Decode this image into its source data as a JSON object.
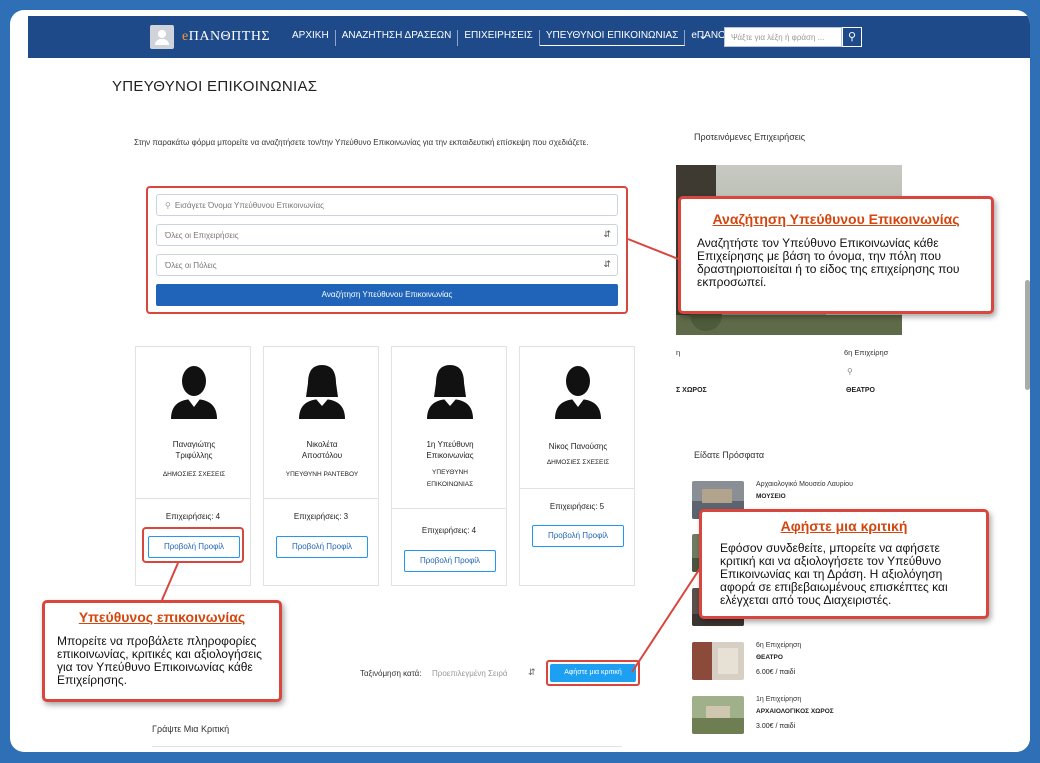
{
  "nav": {
    "logo_e": "e",
    "logo_rest": "ΠΑΝΘΠΤΗΣ",
    "links": [
      "ΑΡΧΙΚΗ",
      "ΑΝΑΖΗΤΗΣΗ ΔΡΑΣΕΩΝ",
      "ΕΠΙΧΕΙΡΗΣΕΙΣ",
      "ΥΠΕΥΘΥΝΟΙ ΕΠΙΚΟΙΝΩΝΙΑΣ",
      "eΠΑΝΟΠΤΗΣ"
    ],
    "search_placeholder": "Ψάξτε για λέξη ή φράση ...",
    "search_icon": "search-icon",
    "chevron_icon": "chevron-down-icon"
  },
  "page": {
    "title": "ΥΠΕΥΘΥΝΟΙ ΕΠΙΚΟΙΝΩΝΙΑΣ",
    "intro": "Στην παρακάτω φόρμα μπορείτε να αναζητήσετε τον/την Υπεύθυνο Επικοινωνίας για την εκπαιδευτική επίσκεψη που σχεδιάζετε."
  },
  "search_form": {
    "name_placeholder": "Εισάγετε Όνομα Υπεύθυνου Επικοινωνίας",
    "business_select": "Όλες οι Επιχειρήσεις",
    "city_select": "Όλες οι Πόλεις",
    "submit_label": "Αναζήτηση Υπεύθυνου Επικοινωνίας"
  },
  "contacts": [
    {
      "name_line1": "Παναγιώτης",
      "name_line2": "Τριφύλλης",
      "role_line1": "ΔΗΜΟΣΙΕΣ ΣΧΕΣΕΙΣ",
      "role_line2": "",
      "businesses": "Επιχειρήσεις: 4",
      "profile_label": "Προβολή Προφίλ",
      "gender": "male"
    },
    {
      "name_line1": "Νικολέτα",
      "name_line2": "Αποστόλου",
      "role_line1": "ΥΠΕΥΘΥΝΗ ΡΑΝΤΕΒΟΥ",
      "role_line2": "",
      "businesses": "Επιχειρήσεις: 3",
      "profile_label": "Προβολή Προφίλ",
      "gender": "female"
    },
    {
      "name_line1": "1η Υπεύθυνη",
      "name_line2": "Επικοινωνίας",
      "role_line1": "ΥΠΕΥΘΥΝΗ",
      "role_line2": "ΕΠΙΚΟΙΝΩΝΙΑΣ",
      "businesses": "Επιχειρήσεις: 4",
      "profile_label": "Προβολή Προφίλ",
      "gender": "female"
    },
    {
      "name_line1": "Νίκος Πανούσης",
      "name_line2": "",
      "role_line1": "ΔΗΜΟΣΙΕΣ ΣΧΕΣΕΙΣ",
      "role_line2": "",
      "businesses": "Επιχειρήσεις: 5",
      "profile_label": "Προβολή Προφίλ",
      "gender": "male"
    }
  ],
  "sorting": {
    "label": "Ταξινόμηση κατά:",
    "value": "Προεπιλεγμένη Σειρά",
    "review_button": "Αφήστε μια κριτική"
  },
  "write_review": "Γράψτε Μια Κριτική",
  "sidebar": {
    "promoted_title": "Προτεινόμενες Επιχειρήσεις",
    "promo_left_name": "η",
    "promo_right_name": "6η Επιχείρησ",
    "promo_left_cat": "Σ ΧΩΡΟΣ",
    "promo_right_cat": "ΘΕΑΤΡΟ",
    "pin_icon": "map-pin-icon",
    "recent_title": "Είδατε Πρόσφατα",
    "recent": [
      {
        "name": "Αρχαιολογικό Μουσείο Λαυρίου",
        "category": "ΜΟΥΣΕΙΟ",
        "price": ""
      },
      {
        "name": "",
        "category": "",
        "price": ""
      },
      {
        "name": "",
        "category": "",
        "price": ""
      },
      {
        "name": "6η Επιχείρηση",
        "category": "ΘΕΑΤΡΟ",
        "price": "6.00€ / παιδί"
      },
      {
        "name": "1η Επιχείρηση",
        "category": "ΑΡΧΑΙΟΛΟΓΙΚΟΣ ΧΩΡΟΣ",
        "price": "3.00€ / παιδί"
      }
    ]
  },
  "callouts": {
    "search": {
      "title": "Αναζήτηση Υπεύθυνου Επικοινωνίας",
      "body": "Αναζητήστε τον Υπεύθυνο Επικοινωνίας κάθε Επιχείρησης με βάση το όνομα, την πόλη που δραστηριοποιείται ή το είδος της επιχείρησης που εκπροσωπεί."
    },
    "review": {
      "title": "Αφήστε μια κριτική",
      "body": "Εφόσον συνδεθείτε, μπορείτε να αφήσετε κριτική και να αξιολογήσετε τον Υπεύθυνο Επικοινωνίας και τη Δράση. Η αξιολόγηση αφορά σε επιβεβαιωμένους επισκέπτες και ελέγχεται από τους Διαχειριστές."
    },
    "contact": {
      "title": "Υπεύθυνος επικοινωνίας",
      "body": "Μπορείτε να προβάλετε πληροφορίες επικοινωνίας, κριτικές και αξιολογήσεις για τον Υπεύθυνο Επικοινωνίας κάθε Επιχείρησης."
    }
  },
  "colors": {
    "nav": "#1e4a8a",
    "accent": "#1f64b8",
    "highlight": "#d9463e",
    "callout_title": "#d4460f",
    "frame": "#2e6fb6"
  }
}
